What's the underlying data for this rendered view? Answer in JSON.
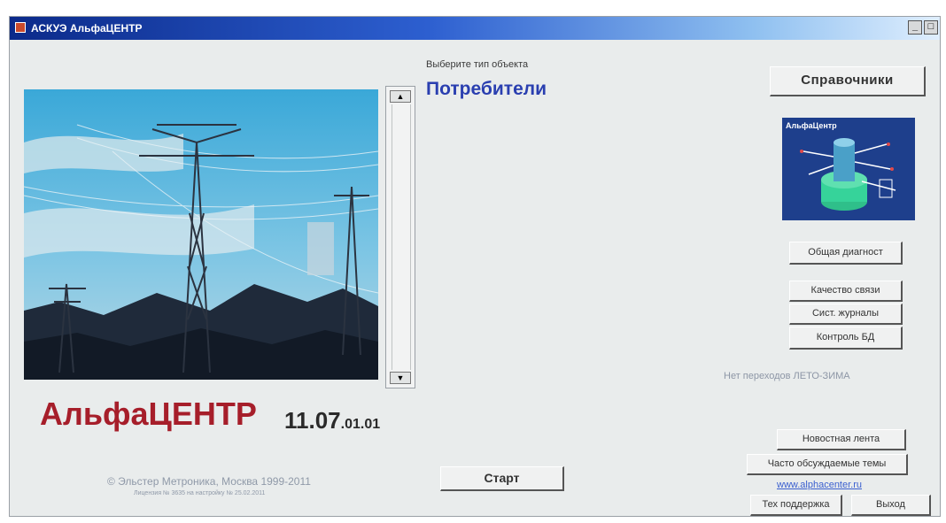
{
  "window": {
    "title": "АСКУЭ АльфаЦЕНТР",
    "controls": [
      "_",
      "□"
    ]
  },
  "object_selector": {
    "label": "Выберите тип объекта",
    "value": "Потребители",
    "scroll_up": "▲",
    "scroll_down": "▼"
  },
  "branding": {
    "product": "АльфаЦЕНТР",
    "version_major": "11.07",
    "version_minor": ".01.01",
    "copyright": "© Эльстер Метроника, Москва 1999-2011",
    "copyright_note": "Лицензия № 3635 на настройку № 25.02.2011"
  },
  "preview": {
    "title": "АльфаЦентр"
  },
  "buttons": {
    "references": "Справочники",
    "general_diagnostics": "Общая диагност",
    "link_quality": "Качество связи",
    "system_logs": "Сист. журналы",
    "db_control": "Контроль БД",
    "news_feed": "Новостная лента",
    "faq": "Часто обсуждаемые темы",
    "tech_support": "Тех поддержка",
    "exit": "Выход",
    "start": "Старт"
  },
  "status": {
    "dst_message": "Нет переходов ЛЕТО-ЗИМА"
  },
  "links": {
    "website": "www.alphacenter.ru"
  },
  "colors": {
    "brand_red": "#a61e2a",
    "selector_blue": "#2a3fb0",
    "title_bar": "#0b2a8a",
    "window_bg": "#e9ecec"
  }
}
